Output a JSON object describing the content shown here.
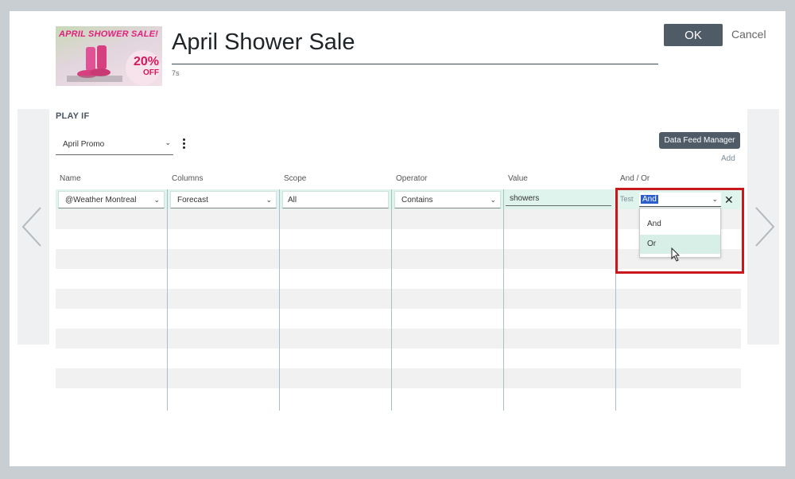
{
  "media": {
    "thumbnail": {
      "banner_text": "APRIL SHOWER SALE!",
      "discount": "20%",
      "discount_suffix": "OFF"
    },
    "title": "April Shower Sale",
    "duration": "7s"
  },
  "actions": {
    "ok_label": "OK",
    "cancel_label": "Cancel"
  },
  "play_if": {
    "section_label": "PLAY IF",
    "promo_selected": "April Promo",
    "data_feed_manager_label": "Data Feed Manager",
    "add_label": "Add"
  },
  "table": {
    "columns": [
      "Name",
      "Columns",
      "Scope",
      "Operator",
      "Value",
      "And / Or"
    ],
    "row": {
      "name": "@Weather Montreal",
      "column": "Forecast",
      "scope": "All",
      "operator": "Contains",
      "value": "showers",
      "test_label": "Test",
      "and_or": "And"
    },
    "and_or_options": [
      "And",
      "Or"
    ],
    "hovered_option": "Or"
  },
  "colors": {
    "primary_button": "#4f5b66",
    "row_highlight": "#dff4ec",
    "option_hover": "#d7efe6",
    "callout_border": "#c8171d",
    "text_selection": "#2b5ec9"
  },
  "icons": {
    "prev": "chevron-left-icon",
    "next": "chevron-right-icon",
    "more": "kebab-menu-icon",
    "dropdown": "chevron-down-icon",
    "remove": "close-icon",
    "pointer": "mouse-cursor-icon"
  }
}
